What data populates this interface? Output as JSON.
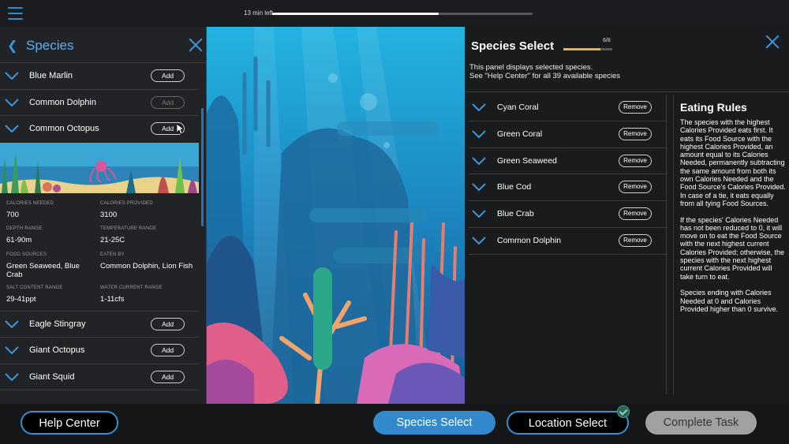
{
  "timer": {
    "label": "13 min left",
    "progress": 0.64
  },
  "species_panel": {
    "title": "Species",
    "rows_top": [
      {
        "name": "Blue Marlin",
        "action": "Add",
        "enabled": true
      },
      {
        "name": "Common Dolphin",
        "action": "Add",
        "enabled": false
      },
      {
        "name": "Common Octopus",
        "action": "Add",
        "enabled": true
      }
    ],
    "detail": {
      "calories_needed_label": "CALORIES NEEDED",
      "calories_needed": "700",
      "calories_provided_label": "CALORIES PROVIDED",
      "calories_provided": "3100",
      "depth_range_label": "DEPTH RANGE",
      "depth_range": "61-90m",
      "temperature_range_label": "TEMPERATURE RANGE",
      "temperature_range": "21-25C",
      "food_sources_label": "FOOD SOURCES",
      "food_sources": "Green Seaweed, Blue Crab",
      "eaten_by_label": "EATEN BY",
      "eaten_by": "Common Dolphin, Lion Fish",
      "salt_content_label": "SALT CONTENT RANGE",
      "salt_content": "29-41ppt",
      "water_current_label": "WATER CURRENT RANGE",
      "water_current": "1-11cfs"
    },
    "rows_bottom": [
      {
        "name": "Eagle Stingray",
        "action": "Add"
      },
      {
        "name": "Giant Octopus",
        "action": "Add"
      },
      {
        "name": "Giant Squid",
        "action": "Add"
      }
    ]
  },
  "selection": {
    "title": "Species Select",
    "count": "6/8",
    "progress": 0.75,
    "desc_line1": "This panel displays selected species.",
    "desc_line2": "See \"Help Center\" for all 39 available species",
    "items": [
      {
        "name": "Cyan Coral",
        "action": "Remove"
      },
      {
        "name": "Green Coral",
        "action": "Remove"
      },
      {
        "name": "Green Seaweed",
        "action": "Remove"
      },
      {
        "name": "Blue Cod",
        "action": "Remove"
      },
      {
        "name": "Blue Crab",
        "action": "Remove"
      },
      {
        "name": "Common Dolphin",
        "action": "Remove"
      }
    ]
  },
  "rules": {
    "title": "Eating Rules",
    "text": "The species with the highest Calories Provided eats first. It eats its Food Source with the highest Calories Provided, an amount equal to its Calories Needed, permanently subtracting the same amount from both its own Calories Needed and the Food Source's Calories Provided. In case of a tie, it eats equally from all tying Food Sources.\n\nIf the species' Calories Needed has not been reduced to 0, it will move on to eat the Food Source with the next highest current Calories Provided; otherwise, the species with the next highest current Calories Provided will take turn to eat.\n\nSpecies ending with Calories Needed at 0 and Calories Provided higher than 0 survive."
  },
  "bottom": {
    "help_center": "Help Center",
    "species_select": "Species Select",
    "location_select": "Location Select",
    "complete_task": "Complete Task"
  },
  "colors": {
    "accent": "#3289cc",
    "progress_gold": "#e9b43a"
  }
}
